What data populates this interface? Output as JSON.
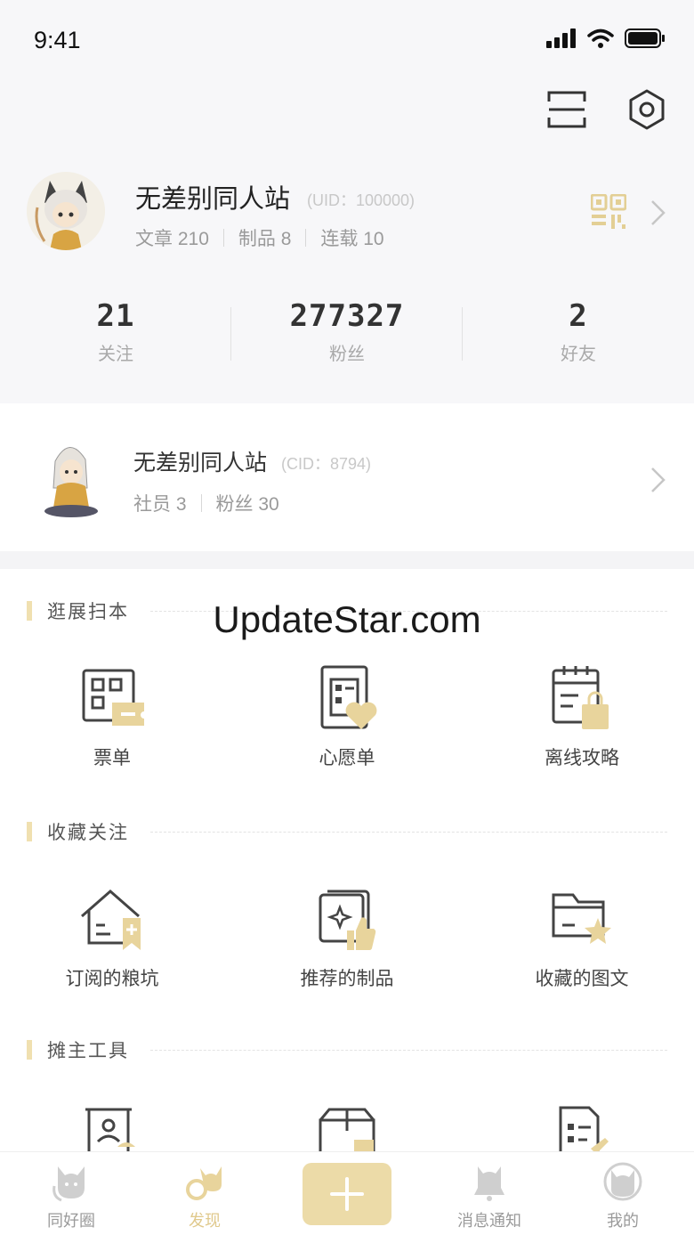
{
  "status_bar": {
    "time": "9:41"
  },
  "profile": {
    "name": "无差别同人站",
    "uid": "(UID：100000)",
    "articles_label": "文章 210",
    "products_label": "制品 8",
    "serials_label": "连载 10"
  },
  "counts": [
    {
      "value": "21",
      "label": "关注"
    },
    {
      "value": "277327",
      "label": "粉丝"
    },
    {
      "value": "2",
      "label": "好友"
    }
  ],
  "club": {
    "name": "无差别同人站",
    "cid": "(CID：8794)",
    "members_label": "社员 3",
    "fans_label": "粉丝 30"
  },
  "sections": [
    {
      "title": "逛展扫本",
      "items": [
        {
          "label": "票单"
        },
        {
          "label": "心愿单"
        },
        {
          "label": "离线攻略"
        }
      ]
    },
    {
      "title": "收藏关注",
      "items": [
        {
          "label": "订阅的粮坑"
        },
        {
          "label": "推荐的制品"
        },
        {
          "label": "收藏的图文"
        }
      ]
    },
    {
      "title": "摊主工具",
      "items": [
        {
          "label": ""
        },
        {
          "label": ""
        },
        {
          "label": ""
        }
      ]
    }
  ],
  "watermark": "UpdateStar.com",
  "tabs": [
    {
      "label": "同好圈"
    },
    {
      "label": "发现"
    },
    {
      "label": ""
    },
    {
      "label": "消息通知"
    },
    {
      "label": "我的"
    }
  ],
  "colors": {
    "accent": "#e8d49c",
    "background_top": "#f7f7f9"
  }
}
